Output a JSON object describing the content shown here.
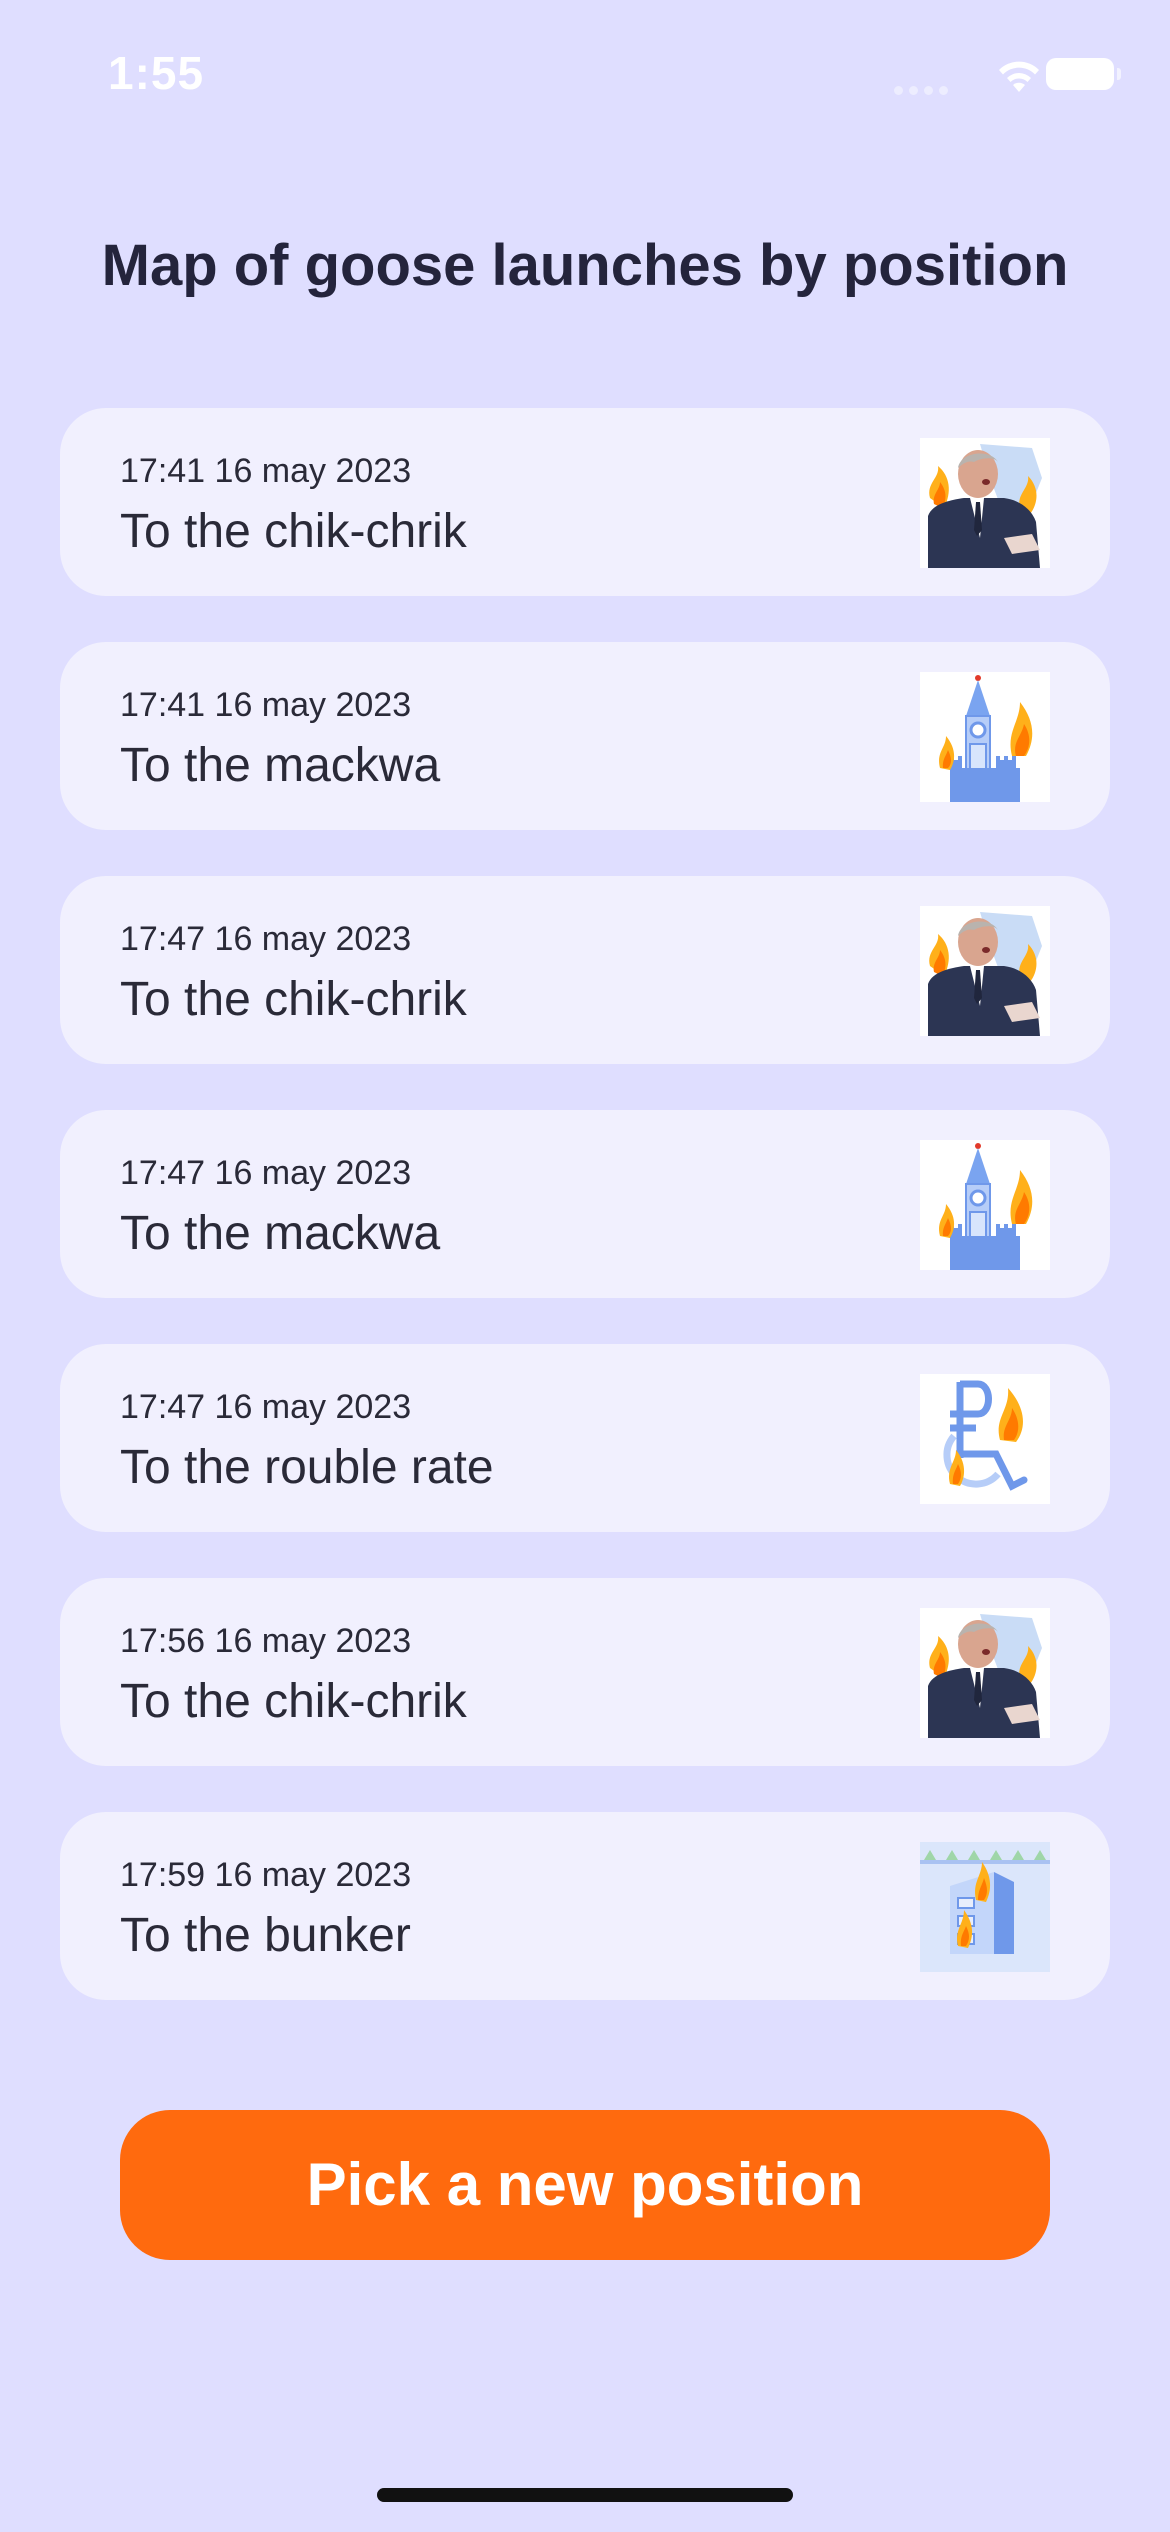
{
  "status_bar": {
    "time": "1:55",
    "icons": [
      "signal-icon",
      "wifi-icon",
      "battery-icon"
    ]
  },
  "page": {
    "title": "Map of goose launches by position"
  },
  "launches": [
    {
      "time": "17:41 16 may 2023",
      "target": "To the chik-chrik",
      "icon": "chik-chrik-icon"
    },
    {
      "time": "17:41 16 may 2023",
      "target": "To the mackwa",
      "icon": "kremlin-tower-icon"
    },
    {
      "time": "17:47 16 may 2023",
      "target": "To the chik-chrik",
      "icon": "chik-chrik-icon"
    },
    {
      "time": "17:47 16 may 2023",
      "target": "To the mackwa",
      "icon": "kremlin-tower-icon"
    },
    {
      "time": "17:47 16 may 2023",
      "target": "To the rouble rate",
      "icon": "rouble-wheelchair-icon"
    },
    {
      "time": "17:56 16 may 2023",
      "target": "To the chik-chrik",
      "icon": "chik-chrik-icon"
    },
    {
      "time": "17:59 16 may 2023",
      "target": "To the bunker",
      "icon": "bunker-icon"
    }
  ],
  "actions": {
    "new_position_label": "Pick a new position"
  },
  "colors": {
    "background": "#dfdeff",
    "card": "#f1f0fe",
    "accent": "#ff6a0e",
    "fire": "#ff9a0a"
  }
}
